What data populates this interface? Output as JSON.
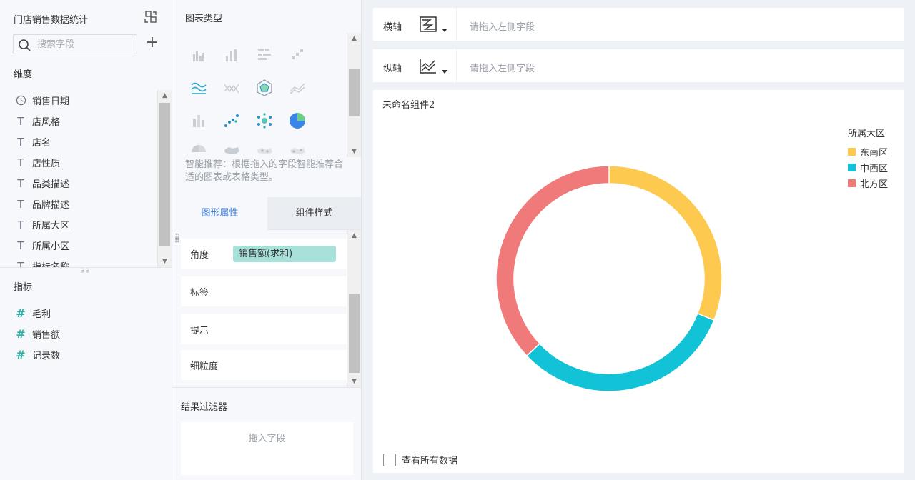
{
  "left_panel": {
    "title": "门店销售数据统计",
    "search_placeholder": "搜索字段",
    "dimension_label": "维度",
    "dimensions": [
      {
        "label": "销售日期",
        "icon": "clock-icon"
      },
      {
        "label": "店风格",
        "icon": "text-type-icon"
      },
      {
        "label": "店名",
        "icon": "text-type-icon"
      },
      {
        "label": "店性质",
        "icon": "text-type-icon"
      },
      {
        "label": "品类描述",
        "icon": "text-type-icon"
      },
      {
        "label": "品牌描述",
        "icon": "text-type-icon"
      },
      {
        "label": "所属大区",
        "icon": "text-type-icon"
      },
      {
        "label": "所属小区",
        "icon": "text-type-icon"
      },
      {
        "label": "指标名称",
        "icon": "text-type-icon"
      }
    ],
    "measure_label": "指标",
    "measures": [
      {
        "label": "毛利",
        "icon": "hash-icon"
      },
      {
        "label": "销售额",
        "icon": "hash-icon"
      },
      {
        "label": "记录数",
        "icon": "hash-icon"
      }
    ]
  },
  "middle_panel": {
    "chart_type_title": "图表类型",
    "smart_hint": "智能推荐：根据拖入的字段智能推荐合适的图表或表格类型。",
    "tab_graph": "图形属性",
    "tab_style": "组件样式",
    "props": {
      "angle_label": "角度",
      "angle_value": "销售额(求和)",
      "label_label": "标签",
      "tooltip_label": "提示",
      "granularity_label": "细粒度"
    },
    "filter_title": "结果过滤器",
    "filter_placeholder": "拖入字段"
  },
  "axes": {
    "x_label": "横轴",
    "x_placeholder": "请拖入左侧字段",
    "y_label": "纵轴",
    "y_placeholder": "请拖入左侧字段"
  },
  "chart": {
    "title": "未命名组件2",
    "view_all_label": "查看所有数据"
  },
  "chart_data": {
    "type": "pie",
    "donut": true,
    "legend_title": "所属大区",
    "legend_position": "top-right",
    "categories": [
      "东南区",
      "中西区",
      "北方区"
    ],
    "values": [
      31,
      32,
      37
    ],
    "colors": [
      "#fdc94e",
      "#12c2d6",
      "#f07a7a"
    ]
  }
}
